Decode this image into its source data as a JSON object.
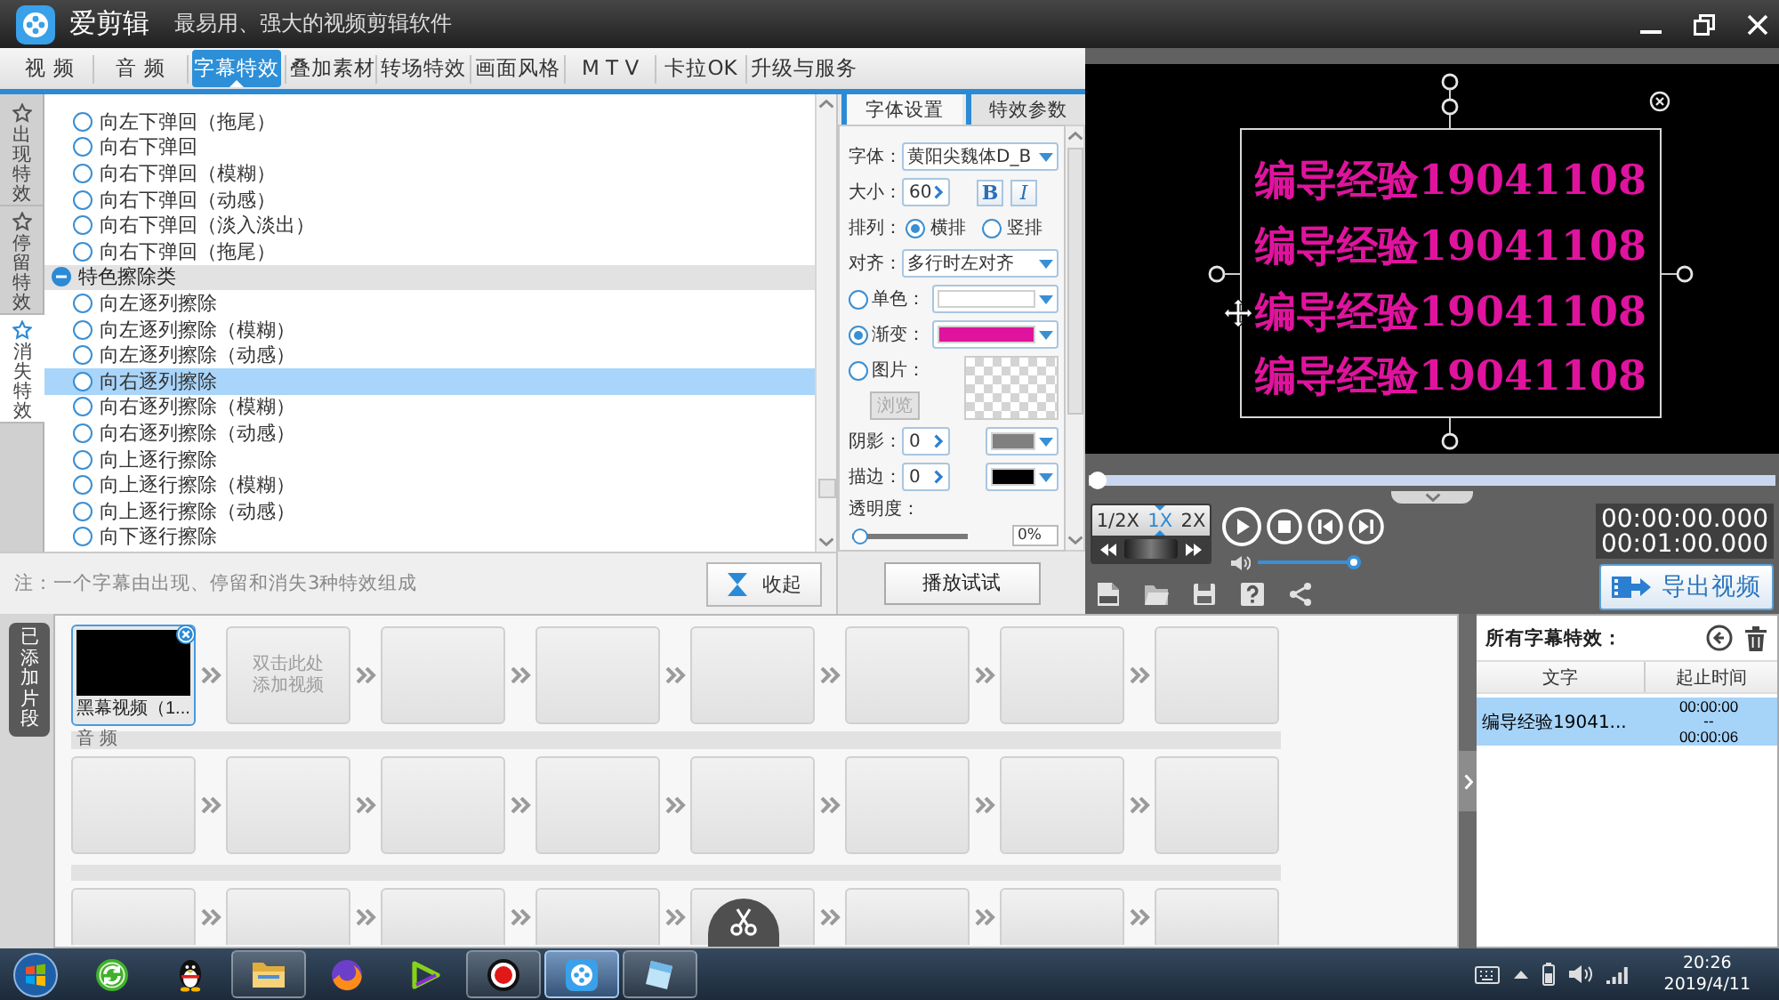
{
  "app": {
    "name": "爱剪辑",
    "tagline": "最易用、强大的视频剪辑软件"
  },
  "main_tabs": [
    {
      "label": "视 频",
      "selected": false
    },
    {
      "label": "音 频",
      "selected": false
    },
    {
      "label": "字幕特效",
      "selected": true
    },
    {
      "label": "叠加素材",
      "selected": false
    },
    {
      "label": "转场特效",
      "selected": false
    },
    {
      "label": "画面风格",
      "selected": false
    },
    {
      "label": "M T V",
      "selected": false
    },
    {
      "label": "卡拉OK",
      "selected": false
    },
    {
      "label": "升级与服务",
      "selected": false
    }
  ],
  "effect_categories": [
    {
      "label": "出现特效",
      "selected": false
    },
    {
      "label": "停留特效",
      "selected": false
    },
    {
      "label": "消失特效",
      "selected": true
    }
  ],
  "effects": [
    {
      "kind": "item",
      "label": "向左下弹回（拖尾）",
      "selected": false
    },
    {
      "kind": "item",
      "label": "向右下弹回",
      "selected": false
    },
    {
      "kind": "item",
      "label": "向右下弹回（模糊）",
      "selected": false
    },
    {
      "kind": "item",
      "label": "向右下弹回（动感）",
      "selected": false
    },
    {
      "kind": "item",
      "label": "向右下弹回（淡入淡出）",
      "selected": false
    },
    {
      "kind": "item",
      "label": "向右下弹回（拖尾）",
      "selected": false
    },
    {
      "kind": "group",
      "label": "特色擦除类",
      "expanded": true,
      "children": [
        {
          "kind": "item",
          "label": "向左逐列擦除",
          "selected": false
        },
        {
          "kind": "item",
          "label": "向左逐列擦除（模糊）",
          "selected": false
        },
        {
          "kind": "item",
          "label": "向左逐列擦除（动感）",
          "selected": false
        },
        {
          "kind": "item",
          "label": "向右逐列擦除",
          "selected": true
        },
        {
          "kind": "item",
          "label": "向右逐列擦除（模糊）",
          "selected": false
        },
        {
          "kind": "item",
          "label": "向右逐列擦除（动感）",
          "selected": false
        },
        {
          "kind": "item",
          "label": "向上逐行擦除",
          "selected": false
        },
        {
          "kind": "item",
          "label": "向上逐行擦除（模糊）",
          "selected": false
        },
        {
          "kind": "item",
          "label": "向上逐行擦除（动感）",
          "selected": false
        },
        {
          "kind": "item",
          "label": "向下逐行擦除",
          "selected": false
        }
      ]
    }
  ],
  "note": "注：一个字幕由出现、停留和消失3种特效组成",
  "collapse_button": {
    "label": "收起"
  },
  "settings": {
    "tabs": [
      {
        "label": "字体设置",
        "selected": true
      },
      {
        "label": "特效参数",
        "selected": false
      }
    ],
    "font": {
      "label": "字体：",
      "value": "黄阳尖魏体D_B"
    },
    "size": {
      "label": "大小：",
      "value": "60",
      "bold_button": "B",
      "italic_button": "I"
    },
    "arrangement": {
      "label": "排列：",
      "options": [
        {
          "label": "横排",
          "selected": true
        },
        {
          "label": "竖排",
          "selected": false
        }
      ]
    },
    "alignment": {
      "label": "对齐：",
      "value": "多行时左对齐"
    },
    "fill_options": [
      {
        "kind": "solid",
        "label": "单色：",
        "selected": false,
        "color": "#ffffff"
      },
      {
        "kind": "gradient",
        "label": "渐变：",
        "selected": true,
        "color": "#e0139e"
      },
      {
        "kind": "image",
        "label": "图片：",
        "selected": false,
        "button": {
          "label": "浏览",
          "disabled": true
        }
      }
    ],
    "line_styles": [
      {
        "label": "阴影：",
        "value": "0",
        "color": "#808080"
      },
      {
        "label": "描边：",
        "value": "0",
        "color": "#000000"
      }
    ],
    "opacity": {
      "label": "透明度：",
      "level": 0,
      "value": "0%"
    },
    "preview_button": {
      "label": "播放试试"
    }
  },
  "preview": {
    "caption_lines": [
      "编导经验19041108",
      "编导经验19041108",
      "编导经验19041108",
      "编导经验19041108"
    ]
  },
  "playback": {
    "progress": {
      "level": 0
    },
    "speeds": [
      {
        "label": "1/2X",
        "selected": false
      },
      {
        "label": "1X",
        "selected": true
      },
      {
        "label": "2X",
        "selected": false
      }
    ],
    "volume": {
      "level": 1
    },
    "current_time": "00:00:00.000",
    "total_time": "00:01:00.000"
  },
  "export_button": {
    "label": "导出视频"
  },
  "timeline": {
    "tab_label": "已添加片段",
    "video_track": {
      "clips": [
        {
          "kind": "clip",
          "label": "黑幕视频（1...",
          "selected": true
        },
        {
          "kind": "placeholder",
          "label": "双击此处添加视频",
          "selected": false
        },
        {
          "kind": "empty",
          "selected": false
        },
        {
          "kind": "empty",
          "selected": false
        },
        {
          "kind": "empty",
          "selected": false
        },
        {
          "kind": "empty",
          "selected": false
        },
        {
          "kind": "empty",
          "selected": false
        },
        {
          "kind": "empty",
          "selected": false
        }
      ]
    },
    "audio_track": {
      "label": "音 频",
      "slots": [
        {
          "kind": "empty",
          "selected": false
        },
        {
          "kind": "empty",
          "selected": false
        },
        {
          "kind": "empty",
          "selected": false
        },
        {
          "kind": "empty",
          "selected": false
        },
        {
          "kind": "empty",
          "selected": false
        },
        {
          "kind": "empty",
          "selected": false
        },
        {
          "kind": "empty",
          "selected": false
        },
        {
          "kind": "empty",
          "selected": false
        }
      ]
    },
    "track_3": {
      "slots": [
        {
          "kind": "empty",
          "selected": false
        },
        {
          "kind": "empty",
          "selected": false
        },
        {
          "kind": "empty",
          "selected": false
        },
        {
          "kind": "empty",
          "selected": false
        },
        {
          "kind": "empty",
          "selected": false
        },
        {
          "kind": "empty",
          "selected": false
        },
        {
          "kind": "empty",
          "selected": false
        },
        {
          "kind": "empty",
          "selected": false
        }
      ]
    }
  },
  "caption_effects": {
    "title": "所有字幕特效：",
    "columns": [
      "文字",
      "起止时间"
    ],
    "rows": [
      {
        "text": "编导经验19041...",
        "time_range": "00:00:00 -- 00:00:06",
        "selected": true
      }
    ]
  },
  "taskbar": {
    "apps": [
      {
        "kind": "refresh",
        "running": false,
        "selected": false
      },
      {
        "kind": "penguin",
        "running": false,
        "selected": false
      },
      {
        "kind": "folder",
        "running": true,
        "selected": false
      },
      {
        "kind": "browser",
        "running": false,
        "selected": false
      },
      {
        "kind": "media",
        "running": false,
        "selected": false
      },
      {
        "kind": "recorder",
        "running": true,
        "selected": false
      },
      {
        "kind": "editor",
        "running": true,
        "selected": true
      },
      {
        "kind": "notepad",
        "running": true,
        "selected": false
      }
    ],
    "clock": {
      "time": "20:26",
      "date": "2019/4/11"
    }
  }
}
